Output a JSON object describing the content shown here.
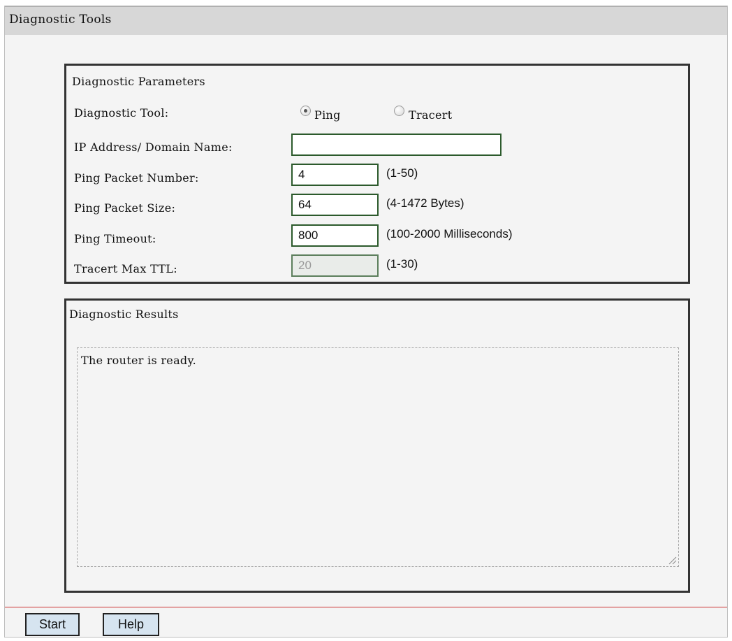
{
  "page_title": "Diagnostic Tools",
  "parameters": {
    "section_title": "Diagnostic Parameters",
    "tool_label": "Diagnostic Tool:",
    "tool_options": [
      {
        "label": "Ping",
        "checked": true
      },
      {
        "label": "Tracert",
        "checked": false
      }
    ],
    "ip_label": "IP Address/ Domain Name:",
    "ip_value": "",
    "ping_count_label": "Ping Packet Number:",
    "ping_count_value": "4",
    "ping_count_hint": "(1-50)",
    "ping_size_label": "Ping Packet Size:",
    "ping_size_value": "64",
    "ping_size_hint": "(4-1472 Bytes)",
    "ping_timeout_label": "Ping Timeout:",
    "ping_timeout_value": "800",
    "ping_timeout_hint": "(100-2000 Milliseconds)",
    "ttl_label": "Tracert Max TTL:",
    "ttl_value": "20",
    "ttl_hint": "(1-30)"
  },
  "results": {
    "section_title": "Diagnostic Results",
    "text": "The router is ready."
  },
  "buttons": {
    "start": "Start",
    "help": "Help"
  }
}
